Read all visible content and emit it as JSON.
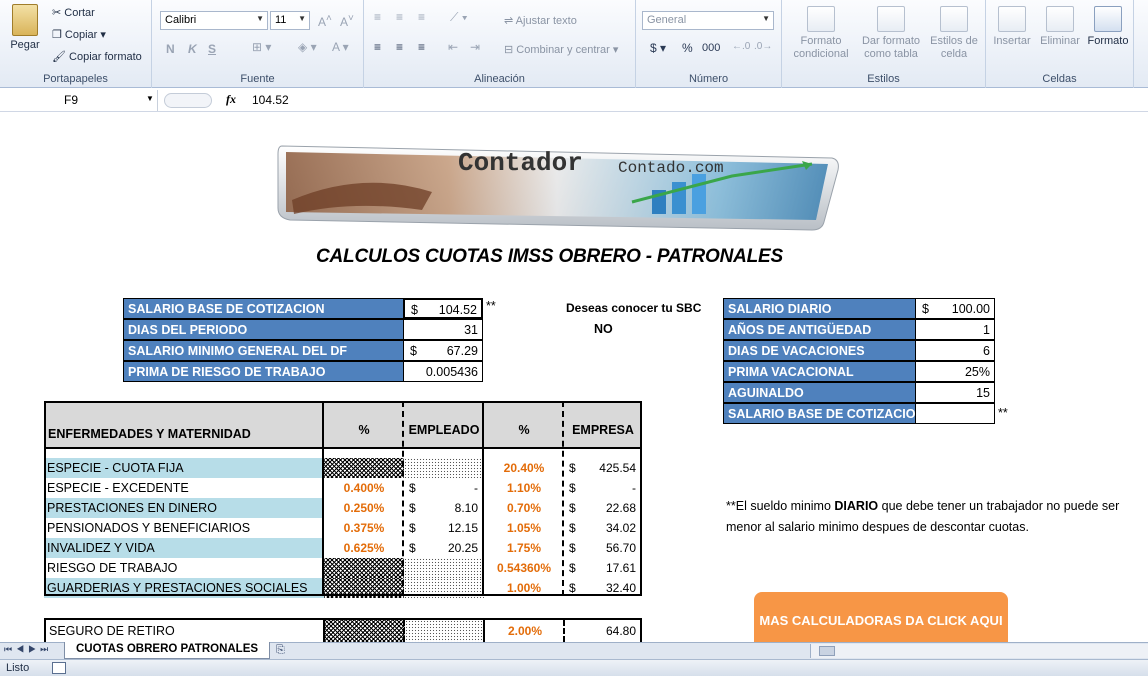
{
  "ribbon": {
    "clipboard": {
      "paste": "Pegar",
      "cut": "Cortar",
      "copy": "Copiar",
      "format_painter": "Copiar formato",
      "group": "Portapapeles"
    },
    "font": {
      "name": "Calibri",
      "size": "11",
      "bold": "N",
      "italic": "K",
      "underline": "S",
      "group": "Fuente"
    },
    "alignment": {
      "wrap": "Ajustar texto",
      "merge": "Combinar y centrar",
      "group": "Alineación"
    },
    "number": {
      "format": "General",
      "currency": "$",
      "percent": "%",
      "thousands": "000",
      "group": "Número"
    },
    "styles": {
      "conditional": "Formato condicional",
      "as_table": "Dar formato como tabla",
      "cell_styles": "Estilos de celda",
      "group": "Estilos"
    },
    "cells": {
      "insert": "Insertar",
      "delete": "Eliminar",
      "format": "Formato",
      "group": "Celdas"
    }
  },
  "formula_bar": {
    "name_box": "F9",
    "fx": "fx",
    "value": "104.52"
  },
  "sheet": {
    "logo_text": "Contador",
    "logo_text2": "Contado.com",
    "title": "CALCULOS CUOTAS IMSS OBRERO - PATRONALES",
    "inputs": [
      {
        "label": "SALARIO BASE DE COTIZACION",
        "currency": "$",
        "value": "104.52"
      },
      {
        "label": "DIAS DEL PERIODO",
        "currency": "",
        "value": "31"
      },
      {
        "label": "SALARIO MINIMO GENERAL DEL DF",
        "currency": "$",
        "value": "67.29"
      },
      {
        "label": "PRIMA DE RIESGO DE TRABAJO",
        "currency": "",
        "value": "0.005436"
      }
    ],
    "asterisk": "**",
    "sbc_question": "Deseas conocer tu SBC",
    "sbc_answer": "NO",
    "side": [
      {
        "label": "SALARIO DIARIO",
        "currency": "$",
        "value": "100.00"
      },
      {
        "label": "AÑOS DE ANTIGÜEDAD",
        "currency": "",
        "value": "1"
      },
      {
        "label": "DIAS DE VACACIONES",
        "currency": "",
        "value": "6"
      },
      {
        "label": "PRIMA VACACIONAL",
        "currency": "",
        "value": "25%"
      },
      {
        "label": "AGUINALDO",
        "currency": "",
        "value": "15"
      },
      {
        "label": "SALARIO BASE DE COTIZACION",
        "currency": "",
        "value": ""
      }
    ],
    "table_headers": {
      "concept": "ENFERMEDADES Y MATERNIDAD",
      "pct1": "%",
      "employee": "EMPLEADO",
      "pct2": "%",
      "company": "EMPRESA"
    },
    "rows": [
      {
        "label": "ESPECIE - CUOTA FIJA",
        "pct1": "",
        "emp": "",
        "pct2": "20.40%",
        "comp": "425.54",
        "blue": true,
        "hatch": true
      },
      {
        "label": "ESPECIE - EXCEDENTE",
        "pct1": "0.400%",
        "emp": "-",
        "pct2": "1.10%",
        "comp": "-",
        "blue": false,
        "hatch": false
      },
      {
        "label": "PRESTACIONES EN DINERO",
        "pct1": "0.250%",
        "emp": "8.10",
        "pct2": "0.70%",
        "comp": "22.68",
        "blue": true,
        "hatch": false
      },
      {
        "label": "PENSIONADOS Y BENEFICIARIOS",
        "pct1": "0.375%",
        "emp": "12.15",
        "pct2": "1.05%",
        "comp": "34.02",
        "blue": false,
        "hatch": false
      },
      {
        "label": "INVALIDEZ Y VIDA",
        "pct1": "0.625%",
        "emp": "20.25",
        "pct2": "1.75%",
        "comp": "56.70",
        "blue": true,
        "hatch": false
      },
      {
        "label": "RIESGO DE TRABAJO",
        "pct1": "",
        "emp": "",
        "pct2": "0.54360%",
        "comp": "17.61",
        "blue": false,
        "hatch": true
      },
      {
        "label": "GUARDERIAS Y PRESTACIONES SOCIALES",
        "pct1": "",
        "emp": "",
        "pct2": "1.00%",
        "comp": "32.40",
        "blue": true,
        "hatch": true
      }
    ],
    "retiro": {
      "label": "SEGURO DE RETIRO",
      "pct2": "2.00%",
      "comp": "64.80"
    },
    "note_pre": "**El sueldo minimo ",
    "note_bold": "DIARIO",
    "note_post": " que debe tener un trabajador no puede ser menor al salario minimo despues de descontar cuotas.",
    "more_button": "MAS CALCULADORAS DA CLICK AQUI"
  },
  "sheet_tab": "CUOTAS OBRERO PATRONALES",
  "status": "Listo"
}
